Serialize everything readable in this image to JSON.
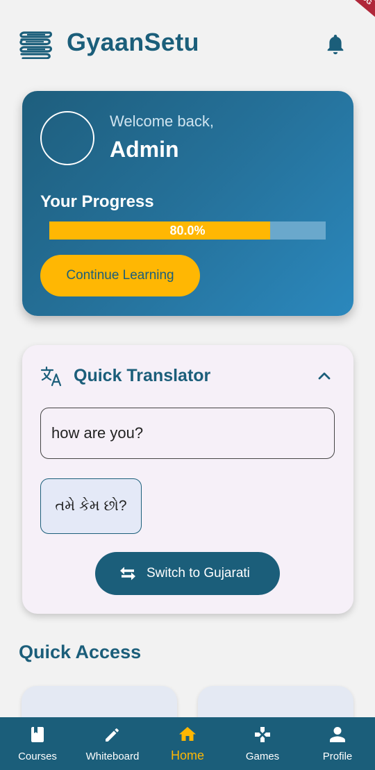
{
  "header": {
    "title": "GyaanSetu",
    "logo_icon": "books-stack-icon",
    "notification_icon": "bell-icon",
    "debug_banner": "DEBUG"
  },
  "welcome": {
    "greeting": "Welcome back,",
    "user_name": "Admin",
    "progress_label": "Your Progress",
    "progress_value": 0.8,
    "progress_text": "80.0%",
    "continue_label": "Continue Learning"
  },
  "translator": {
    "title": "Quick Translator",
    "icon": "translate-icon",
    "collapse_icon": "chevron-up-icon",
    "input_value": "how are you?",
    "output_text": "તમે કેમ છો?",
    "switch_label": "Switch to Gujarati",
    "switch_icon": "swap-arrows-icon"
  },
  "quick_access": {
    "title": "Quick Access"
  },
  "bottom_nav": {
    "items": [
      {
        "label": "Courses",
        "icon": "book-icon"
      },
      {
        "label": "Whiteboard",
        "icon": "pencil-icon"
      },
      {
        "label": "Home",
        "icon": "home-icon",
        "active": true
      },
      {
        "label": "Games",
        "icon": "gamepad-icon"
      },
      {
        "label": "Profile",
        "icon": "person-icon"
      }
    ]
  },
  "colors": {
    "primary": "#1b5e7a",
    "accent": "#ffb703",
    "background": "#f2f2f2",
    "card_light": "#f6f0f8"
  }
}
